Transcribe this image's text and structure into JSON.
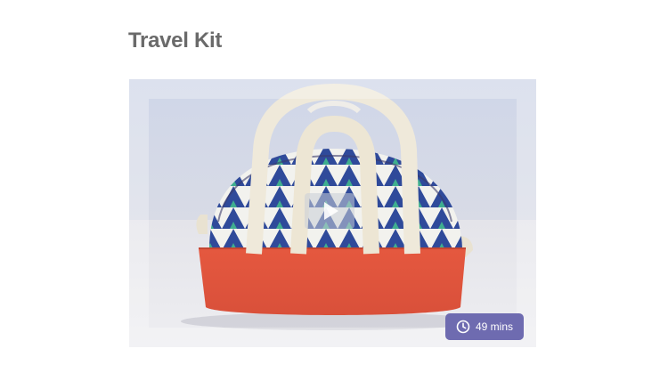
{
  "page": {
    "title": "Travel Kit"
  },
  "video": {
    "thumbnail_alt": "Blue and white triangle-pattern zip bag with coral bottom and cream canvas handles",
    "duration_label": "49 mins",
    "duration_icon": "clock-icon",
    "play_icon": "play-icon"
  },
  "colors": {
    "title_text": "#6a6a6a",
    "badge_bg": "#6e6bb0",
    "bag_blue": "#2f4a9a",
    "bag_coral": "#e2553f",
    "handle_cream": "#efe9da"
  }
}
